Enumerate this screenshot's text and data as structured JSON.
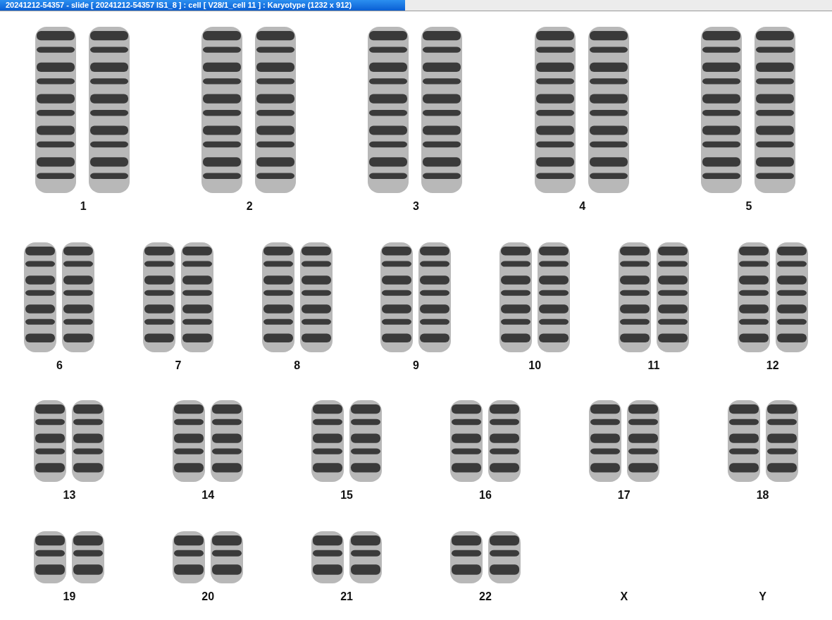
{
  "window": {
    "title": "20241212-54357 - slide [ 20241212-54357 IS1_8 ] : cell [ V28/1_cell 11 ] : Karyotype  (1232 x 912)"
  },
  "rows": [
    {
      "groups": [
        {
          "label": "1",
          "present": true
        },
        {
          "label": "2",
          "present": true
        },
        {
          "label": "3",
          "present": true
        },
        {
          "label": "4",
          "present": true
        },
        {
          "label": "5",
          "present": true
        }
      ]
    },
    {
      "groups": [
        {
          "label": "6",
          "present": true
        },
        {
          "label": "7",
          "present": true
        },
        {
          "label": "8",
          "present": true
        },
        {
          "label": "9",
          "present": true
        },
        {
          "label": "10",
          "present": true
        },
        {
          "label": "11",
          "present": true
        },
        {
          "label": "12",
          "present": true
        }
      ]
    },
    {
      "groups": [
        {
          "label": "13",
          "present": true
        },
        {
          "label": "14",
          "present": true
        },
        {
          "label": "15",
          "present": true
        },
        {
          "label": "16",
          "present": true
        },
        {
          "label": "17",
          "present": true
        },
        {
          "label": "18",
          "present": true
        }
      ]
    },
    {
      "groups": [
        {
          "label": "19",
          "present": true
        },
        {
          "label": "20",
          "present": true
        },
        {
          "label": "21",
          "present": true
        },
        {
          "label": "22",
          "present": true
        },
        {
          "label": "X",
          "present": false
        },
        {
          "label": "Y",
          "present": false
        }
      ]
    }
  ]
}
